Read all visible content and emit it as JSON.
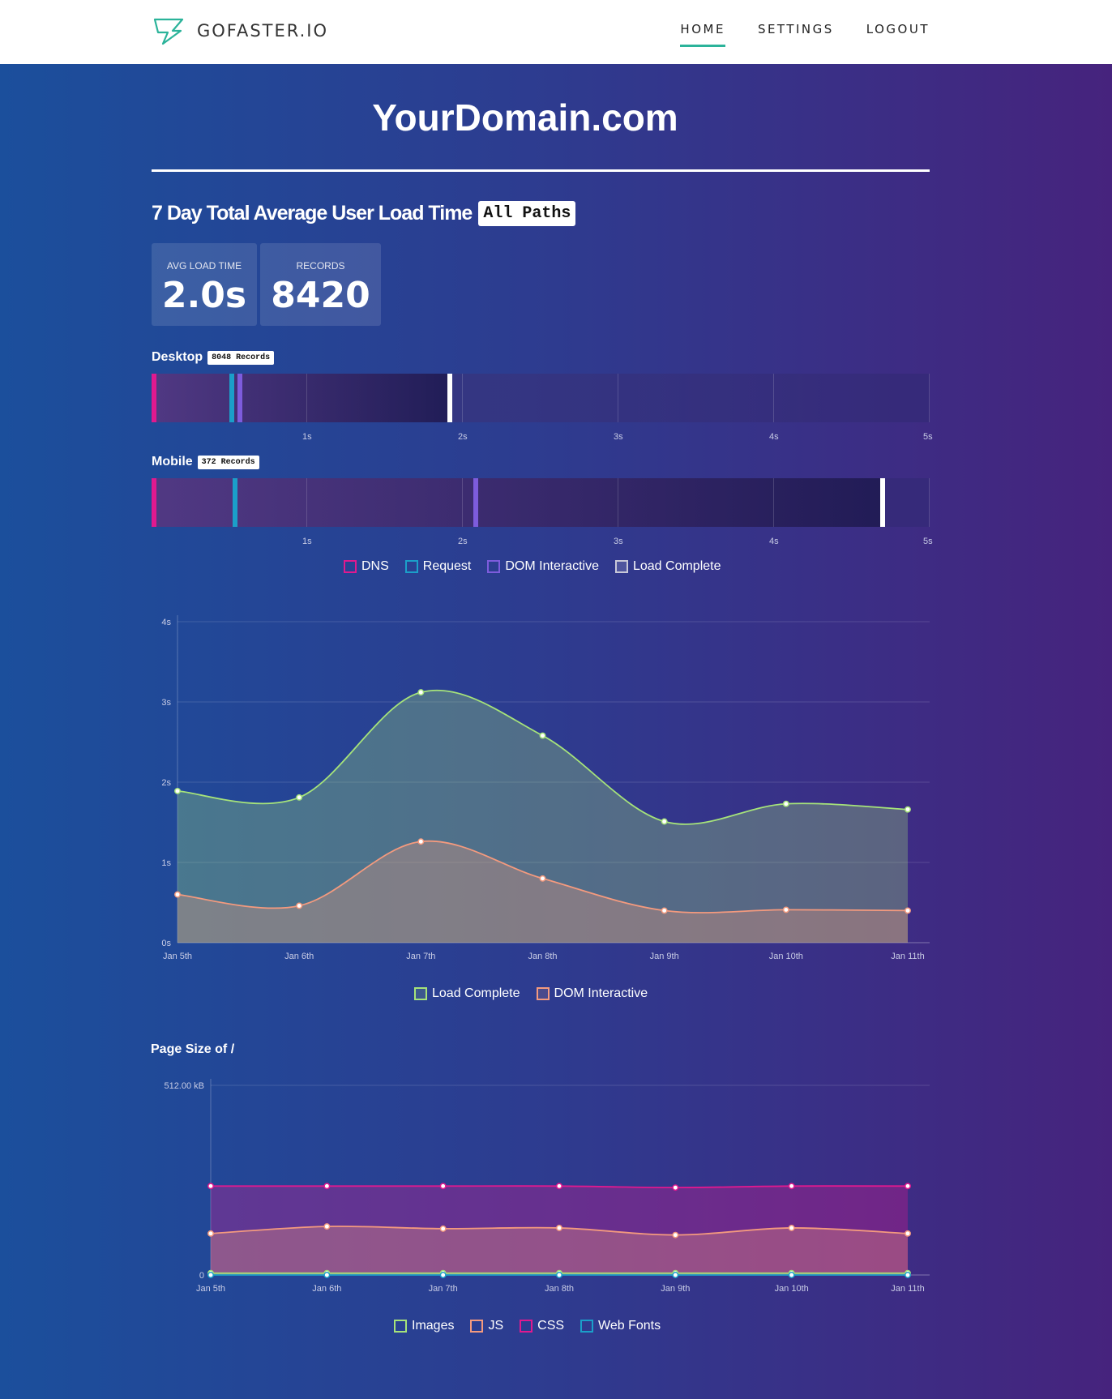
{
  "header": {
    "logo_text": "GOFASTER.IO",
    "nav": [
      {
        "label": "HOME",
        "active": true
      },
      {
        "label": "SETTINGS",
        "active": false
      },
      {
        "label": "LOGOUT",
        "active": false
      }
    ]
  },
  "domain_title": "YourDomain.com",
  "load_time_section": {
    "heading": "7 Day Total Average User Load Time",
    "path_badge": "All Paths",
    "stats": [
      {
        "label": "AVG LOAD TIME",
        "value": "2.0s"
      },
      {
        "label": "RECORDS",
        "value": "8420"
      }
    ]
  },
  "devices": {
    "desktop": {
      "label": "Desktop",
      "records": "8048 Records",
      "timings": {
        "dns": 0.0,
        "request": 0.5,
        "dom_interactive": 0.55,
        "load_complete": 1.9
      }
    },
    "mobile": {
      "label": "Mobile",
      "records": "372 Records",
      "timings": {
        "dns": 0.0,
        "request": 0.52,
        "dom_interactive": 2.07,
        "load_complete": 4.68
      }
    },
    "axis_ticks": [
      "1s",
      "2s",
      "3s",
      "4s",
      "5s"
    ]
  },
  "bar_legend": [
    {
      "label": "DNS",
      "color": "#e0198f"
    },
    {
      "label": "Request",
      "color": "#1b9fc9"
    },
    {
      "label": "DOM Interactive",
      "color": "#7d5cdc"
    },
    {
      "label": "Load Complete",
      "color": "#c8c8d8"
    }
  ],
  "load_chart_legend": [
    {
      "label": "Load Complete",
      "color": "#a6e37a"
    },
    {
      "label": "DOM Interactive",
      "color": "#f49a7e"
    }
  ],
  "page_size_title": "Page Size of /",
  "page_size_legend": [
    {
      "label": "Images",
      "color": "#a6e37a"
    },
    {
      "label": "JS",
      "color": "#f49a7e"
    },
    {
      "label": "CSS",
      "color": "#e0198f"
    },
    {
      "label": "Web Fonts",
      "color": "#1b9fc9"
    }
  ],
  "chart_data": [
    {
      "type": "area",
      "categories": [
        "Jan 5th",
        "Jan 6th",
        "Jan 7th",
        "Jan 8th",
        "Jan 9th",
        "Jan 10th",
        "Jan 11th"
      ],
      "y_ticks": [
        "0s",
        "1s",
        "2s",
        "3s",
        "4s"
      ],
      "ylim": [
        0,
        4
      ],
      "series": [
        {
          "name": "Load Complete",
          "color": "#a6e37a",
          "values": [
            1.89,
            1.81,
            3.12,
            2.58,
            1.51,
            1.73,
            1.66
          ]
        },
        {
          "name": "DOM Interactive",
          "color": "#f49a7e",
          "values": [
            0.6,
            0.46,
            1.26,
            0.8,
            0.4,
            0.41,
            0.4
          ]
        }
      ],
      "grid": true
    },
    {
      "type": "area",
      "categories": [
        "Jan 5th",
        "Jan 6th",
        "Jan 7th",
        "Jan 8th",
        "Jan 9th",
        "Jan 10th",
        "Jan 11th"
      ],
      "y_ticks": [
        "0",
        "512.00 kB"
      ],
      "ylim": [
        0,
        512
      ],
      "series": [
        {
          "name": "CSS",
          "color": "#e0198f",
          "values": [
            240,
            240,
            240,
            240,
            236,
            240,
            240
          ]
        },
        {
          "name": "JS",
          "color": "#f49a7e",
          "values": [
            112,
            131,
            125,
            127,
            108,
            127,
            112
          ]
        },
        {
          "name": "Images",
          "color": "#a6e37a",
          "values": [
            5,
            5,
            5,
            5,
            5,
            5,
            5
          ]
        },
        {
          "name": "Web Fonts",
          "color": "#1b9fc9",
          "values": [
            0,
            0,
            0,
            0,
            0,
            0,
            0
          ]
        }
      ],
      "grid": true
    }
  ]
}
